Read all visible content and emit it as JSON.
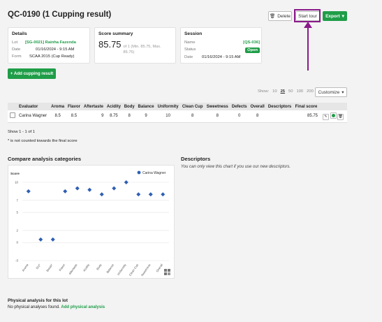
{
  "page": {
    "title": "QC-0190 (1 Cupping result)"
  },
  "header": {
    "delete_label": "Delete",
    "start_tour_label": "Start tour",
    "export_label": "Export"
  },
  "details": {
    "heading": "Details",
    "lot_key": "Lot",
    "lot_value": "[SG-0021] Rainha Fazenda",
    "date_key": "Date",
    "date_value": "01/16/2024 - 9:15 AM",
    "form_key": "Form",
    "form_value": "SCAA 2015 (Cup Ready)"
  },
  "score_summary": {
    "heading": "Score summary",
    "score": "85.75",
    "sub": "of 1 (Min. 85.75, Max. 85.75)"
  },
  "session": {
    "heading": "Session",
    "name_key": "Name",
    "name_value": "[QS-036]",
    "status_key": "Status",
    "status_value": "Open",
    "date_key": "Date",
    "date_value": "01/16/2024 - 9:15 AM"
  },
  "add_cupping_label": "+ Add cupping result",
  "table_controls": {
    "show_label": "Show:",
    "page_sizes": [
      "10",
      "25",
      "50",
      "100",
      "200"
    ],
    "customize_label": "Customize"
  },
  "table": {
    "columns": [
      "Evaluator",
      "Aroma",
      "Flavor",
      "Aftertaste",
      "Acidity",
      "Body",
      "Balance",
      "Uniformity",
      "Clean Cup",
      "Sweetness",
      "Defects",
      "Overall",
      "Descriptors",
      "Final score"
    ],
    "rows": [
      {
        "evaluator": "Carina Wagner",
        "aroma": "8.5",
        "flavor": "8.5",
        "aftertaste": "9",
        "acidity": "8.75",
        "body": "8",
        "balance": "9",
        "uniformity": "10",
        "clean_cup": "8",
        "sweetness": "8",
        "defects": "0",
        "overall": "8",
        "descriptors": "",
        "final_score": "85.75"
      }
    ],
    "footer": "Show 1 - 1 of 1",
    "note": "* is not counted towards the final score"
  },
  "compare": {
    "heading": "Compare analysis categories"
  },
  "descriptors": {
    "heading": "Descriptors",
    "note": "You can only view this chart if you use our new descriptors."
  },
  "physical": {
    "heading": "Physical analysis for this lot",
    "empty_text": "No physical analyses found.",
    "add_link": "Add physical analysis"
  },
  "colors": {
    "accent": "#1f9d48",
    "highlight": "#8a1a8a",
    "series": "#2f5fb3"
  },
  "chart_data": {
    "type": "scatter",
    "title": "",
    "ylabel": "Score",
    "categories": [
      "Aroma",
      "Dry*",
      "Break*",
      "Flavor",
      "Aftertaste",
      "Acidity",
      "Body",
      "Balance",
      "Uniformity",
      "Clean Cup",
      "Sweetness",
      "Overall"
    ],
    "series": [
      {
        "name": "Carina Wagner",
        "values": [
          8.5,
          0.5,
          0.5,
          8.5,
          9,
          8.75,
          8,
          9,
          10,
          8,
          8,
          8
        ]
      }
    ],
    "yticks": [
      "10",
      "7",
      "5",
      "2",
      "0",
      "-3"
    ],
    "ylim": [
      -3,
      10
    ],
    "legend": "top-right",
    "grid": true
  }
}
